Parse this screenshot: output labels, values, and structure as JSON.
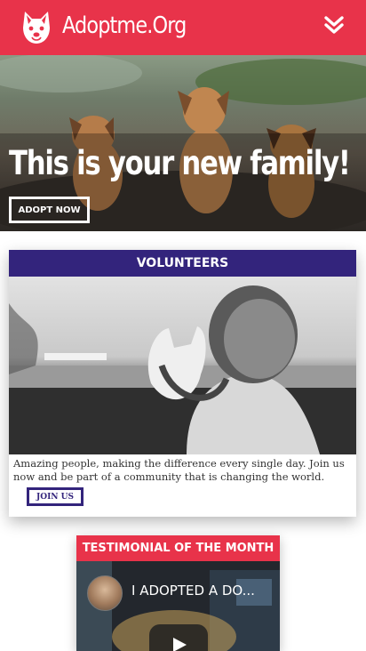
{
  "navbar": {
    "brand": "Adoptme.Org",
    "logo_icon": "dog-face-icon",
    "menu_icon": "double-chevron-down-icon",
    "background": "#e8334a"
  },
  "hero": {
    "title": "This is your new family!",
    "button_label": "ADOPT NOW"
  },
  "volunteers": {
    "heading": "VOLUNTEERS",
    "description": "Amazing people, making the difference every single day. Join us now and be part of a community that is changing the world.",
    "button_label": "JOIN US",
    "accent": "#33247c"
  },
  "testimonial": {
    "heading": "TESTIMONIAL OF THE MONTH",
    "video_title": "I ADOPTED A DO...",
    "play_icon": "play-icon",
    "accent": "#e8334a"
  }
}
